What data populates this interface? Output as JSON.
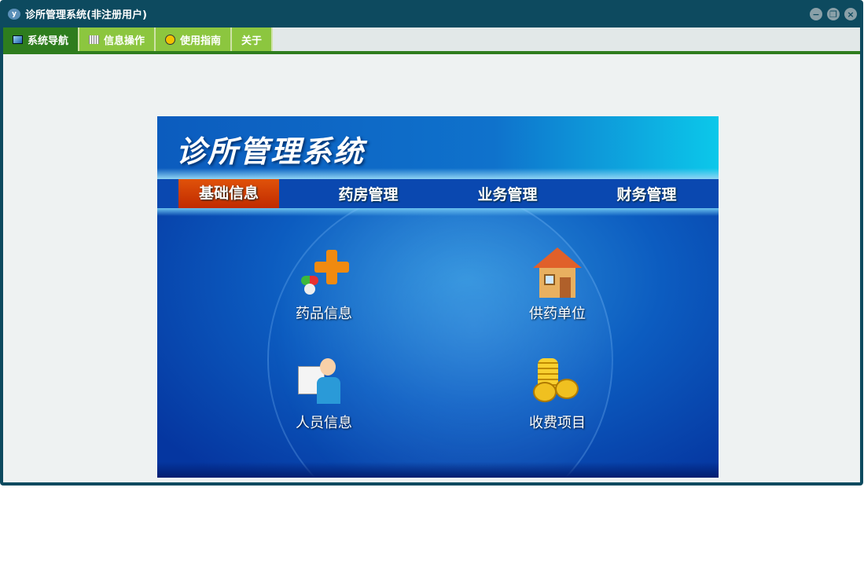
{
  "window": {
    "title": "诊所管理系统(非注册用户)",
    "logo": "yf"
  },
  "tabs": [
    {
      "label": "系统导航",
      "icon": "monitor-icon"
    },
    {
      "label": "信息操作",
      "icon": "grid-icon"
    },
    {
      "label": "使用指南",
      "icon": "help-icon"
    },
    {
      "label": "关于"
    }
  ],
  "banner": {
    "title": "诊所管理系统",
    "nav": [
      "基础信息",
      "药房管理",
      "业务管理",
      "财务管理"
    ]
  },
  "items": [
    {
      "label": "药品信息",
      "icon": "medicine-icon"
    },
    {
      "label": "供药单位",
      "icon": "house-icon"
    },
    {
      "label": "人员信息",
      "icon": "doctor-icon"
    },
    {
      "label": "收费项目",
      "icon": "coins-icon"
    }
  ],
  "colors": {
    "frame": "#0d4a5f",
    "tab": "#8cc63f",
    "tab_active": "#2e7d1e",
    "nav_active": "#d0400a"
  }
}
